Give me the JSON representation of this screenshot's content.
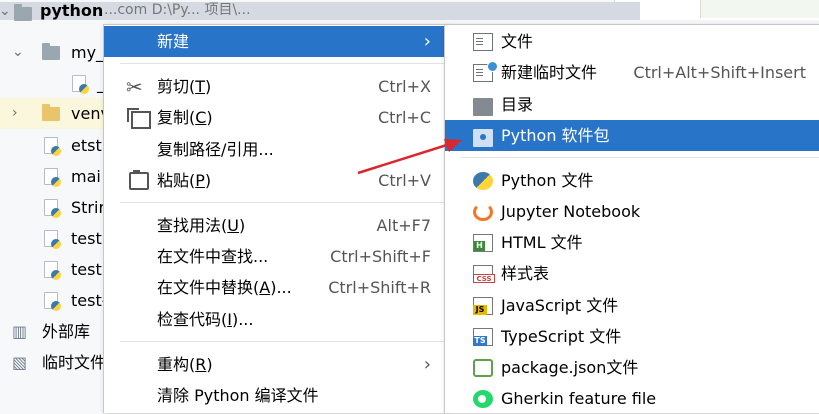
{
  "tree": {
    "root_label": "python",
    "root_path_fragment": "...com  D:\\Py... 项目\\...",
    "items": [
      {
        "label": "my_"
      },
      {
        "label": "_"
      },
      {
        "label": "venv"
      },
      {
        "label": "etst"
      },
      {
        "label": "mai"
      },
      {
        "label": "Strir"
      },
      {
        "label": "test"
      },
      {
        "label": "test"
      },
      {
        "label": "test-"
      },
      {
        "label": "外部库"
      },
      {
        "label": "临时文件"
      }
    ]
  },
  "main_menu": {
    "new": {
      "label": "新建"
    },
    "cut": {
      "label": "剪切(",
      "mnemonic": "T",
      "tail": ")",
      "shortcut": "Ctrl+X"
    },
    "copy": {
      "label": "复制(",
      "mnemonic": "C",
      "tail": ")",
      "shortcut": "Ctrl+C"
    },
    "copy_path": {
      "label": "复制路径/引用..."
    },
    "paste": {
      "label": "粘贴(",
      "mnemonic": "P",
      "tail": ")",
      "shortcut": "Ctrl+V"
    },
    "find_usages": {
      "label": "查找用法(",
      "mnemonic": "U",
      "tail": ")",
      "shortcut": "Alt+F7"
    },
    "find_in_files": {
      "label": "在文件中查找...",
      "shortcut": "Ctrl+Shift+F"
    },
    "replace_in_files": {
      "label": "在文件中替换(",
      "mnemonic": "A",
      "tail": ")...",
      "shortcut": "Ctrl+Shift+R"
    },
    "inspect_code": {
      "label": "检查代码(",
      "mnemonic": "I",
      "tail": ")..."
    },
    "refactor": {
      "label": "重构(",
      "mnemonic": "R",
      "tail": ")"
    },
    "clean_python": {
      "label": "清除 Python 编译文件"
    }
  },
  "sub_menu": {
    "file": {
      "label": "文件"
    },
    "scratch": {
      "label": "新建临时文件",
      "shortcut": "Ctrl+Alt+Shift+Insert"
    },
    "directory": {
      "label": "目录"
    },
    "python_package": {
      "label": "Python 软件包"
    },
    "python_file": {
      "label": "Python 文件"
    },
    "jupyter": {
      "label": "Jupyter Notebook"
    },
    "html": {
      "label": "HTML 文件"
    },
    "stylesheet": {
      "label": "样式表"
    },
    "javascript": {
      "label": "JavaScript 文件"
    },
    "typescript": {
      "label": "TypeScript 文件"
    },
    "package_json": {
      "label": "package.json文件"
    },
    "gherkin": {
      "label": "Gherkin feature file"
    }
  },
  "colors": {
    "highlight": "#2874c9",
    "annotation_arrow": "#d9272e"
  }
}
